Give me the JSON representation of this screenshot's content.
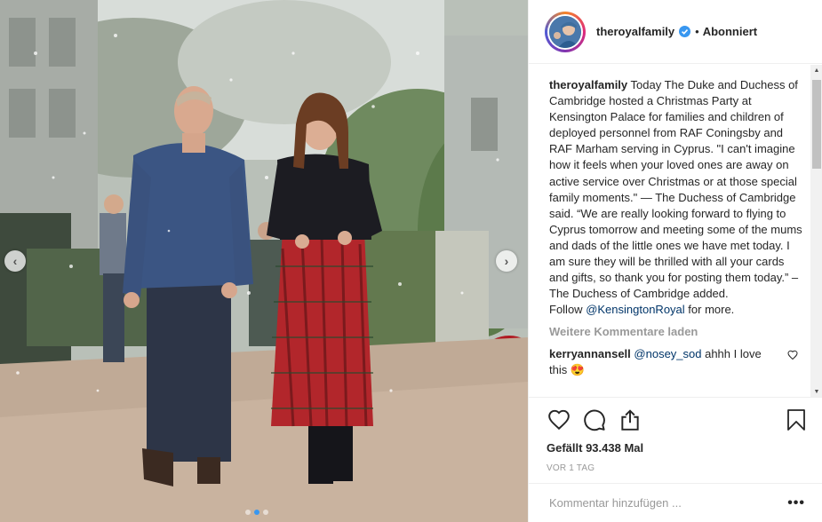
{
  "post": {
    "photo_alt": "Post photo",
    "carousel": {
      "dot_count": 3,
      "active_index": 1
    }
  },
  "header": {
    "username": "theroyalfamily",
    "separator": "•",
    "follow_state": "Abonniert"
  },
  "caption": {
    "author": "theroyalfamily",
    "text": "Today The Duke and Duchess of Cambridge hosted a Christmas Party at Kensington Palace for families and children of deployed personnel from RAF Coningsby and RAF Marham serving in Cyprus. \"I can't imagine how it feels when your loved ones are away on active service over Christmas or at those special family moments.\" — The Duchess of Cambridge said. “We are really looking forward to flying to Cyprus tomorrow and meeting some of the mums and dads of the little ones we have met today. I am sure they will be thrilled with all your cards and gifts, so thank you for posting them today.” – The Duchess of Cambridge added.",
    "follow_prefix": "Follow ",
    "follow_mention": "@KensingtonRoyal",
    "follow_suffix": " for more."
  },
  "comments": {
    "load_more_label": "Weitere Kommentare laden",
    "items": [
      {
        "author": "kerryannansell",
        "mention": "@nosey_sod",
        "text": " ahhh I love this 😍"
      }
    ]
  },
  "actions": {
    "likes": "Gefällt 93.438 Mal",
    "time_ago": "VOR 1 TAG"
  },
  "comment_box": {
    "placeholder": "Kommentar hinzufügen ...",
    "more_label": "•••"
  },
  "icons": {
    "verified": "verified-badge-icon",
    "like": "heart-icon",
    "comment": "comment-bubble-icon",
    "share": "share-icon",
    "save": "bookmark-icon"
  },
  "colors": {
    "verified_blue": "#3897f0",
    "mention_blue": "#003569",
    "muted_gray": "#999999",
    "text": "#262626"
  }
}
